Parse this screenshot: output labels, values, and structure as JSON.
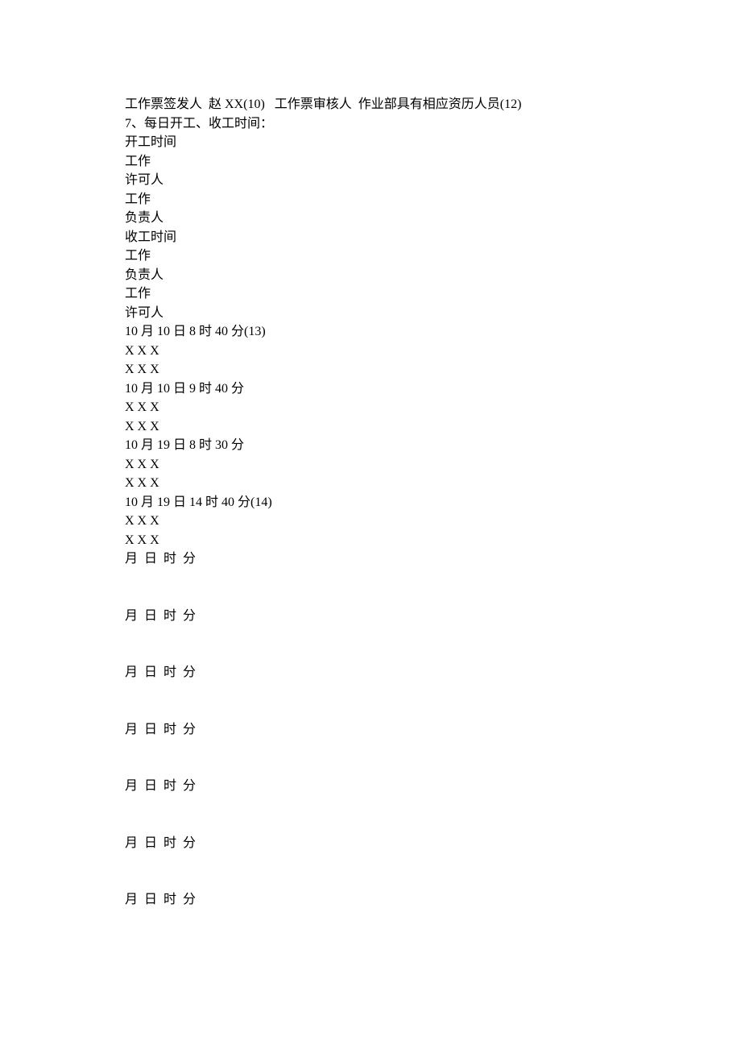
{
  "lines": [
    "工作票签发人  赵 XX(10)   工作票审核人  作业部具有相应资历人员(12)",
    "7、每日开工、收工时间：",
    "开工时间",
    "工作",
    "许可人",
    "工作",
    "负责人",
    "收工时间",
    "工作",
    "负责人",
    "工作",
    "许可人",
    "10 月 10 日 8 时 40 分(13)",
    "X X X",
    "X X X",
    "10 月 10 日 9 时 40 分",
    "X X X",
    "X X X",
    "10 月 19 日 8 时 30 分",
    "X X X",
    "X X X",
    "10 月 19 日 14 时 40 分(14)",
    "X X X",
    "X X X",
    "月  日  时  分",
    "",
    "",
    "月  日  时  分",
    "",
    "",
    "月  日  时  分",
    "",
    "",
    "月  日  时  分",
    "",
    "",
    "月  日  时  分",
    "",
    "",
    "月  日  时  分",
    "",
    "",
    "月  日  时  分"
  ]
}
